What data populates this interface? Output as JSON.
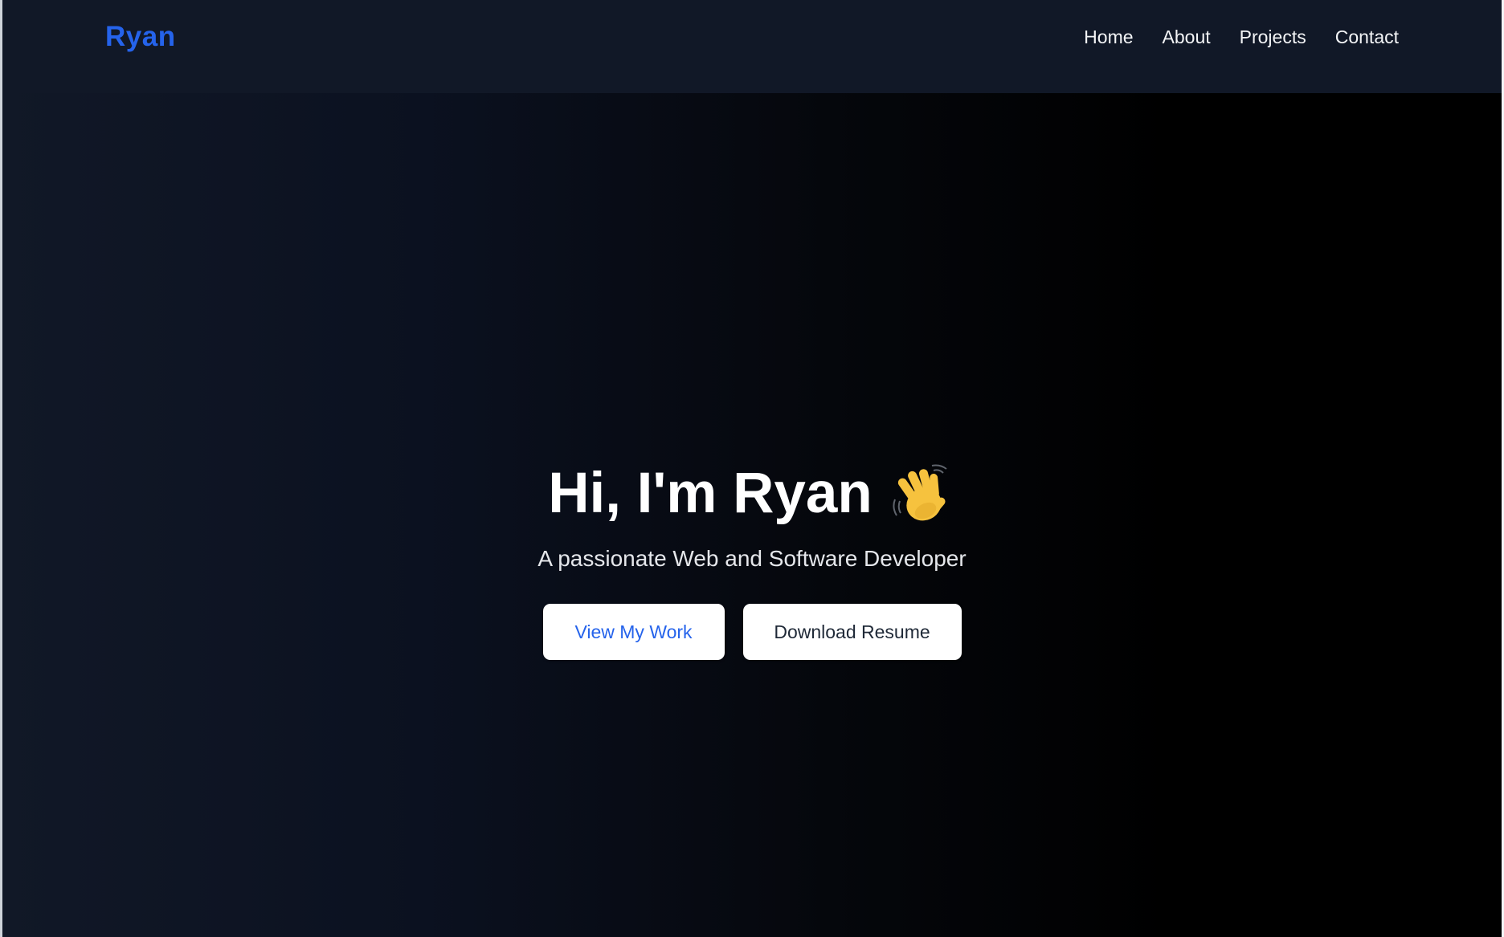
{
  "navbar": {
    "brand": "Ryan",
    "links": [
      {
        "label": "Home"
      },
      {
        "label": "About"
      },
      {
        "label": "Projects"
      },
      {
        "label": "Contact"
      }
    ]
  },
  "hero": {
    "title": "Hi, I'm Ryan",
    "title_icon": "waving-hand-icon",
    "subtitle": "A passionate Web and Software Developer",
    "primary_button": "View My Work",
    "secondary_button": "Download Resume"
  },
  "colors": {
    "brand": "#2563eb",
    "navbar_bg": "#111827",
    "hero_bg_start": "#111827",
    "hero_bg_end": "#000000",
    "button_bg": "#ffffff"
  }
}
